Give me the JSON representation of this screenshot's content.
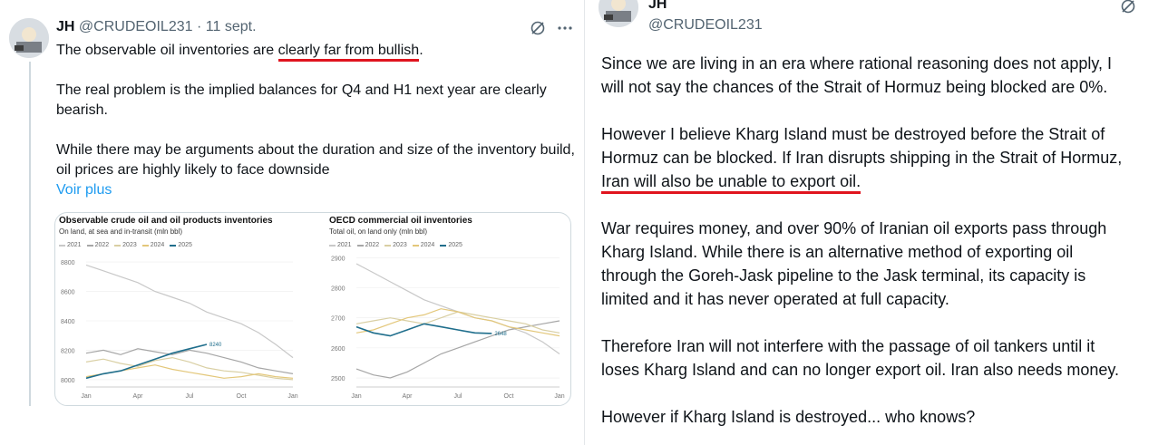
{
  "left_tweet": {
    "author_name": "JH",
    "handle": "@CRUDEOIL231",
    "separator": "·",
    "date": "11 sept.",
    "line1_prefix": "The observable oil inventories are ",
    "line1_highlight": "clearly far from bullish",
    "line1_suffix": ".",
    "para2": "The real problem is the implied balances for Q4 and H1 next year are clearly bearish.",
    "para3": "While there may be arguments about the duration and size of the inventory build, oil prices are highly likely to face downside",
    "see_more": "Voir plus",
    "more_icon": "more-icon",
    "grok_icon": "grok-icon"
  },
  "right_tweet": {
    "author_name": "JH",
    "handle": "@CRUDEOIL231",
    "grok_icon": "grok-icon",
    "lines": {
      "p1a": "Since we are living in an era where rational reasoning does not apply, I",
      "p1b": "will not say the chances of the Strait of Hormuz being blocked are 0%.",
      "p2a": "However I believe Kharg Island must be destroyed before the Strait of",
      "p2b": "Hormuz can be blocked. If Iran disrupts shipping in the Strait of Hormuz,",
      "p2c": "Iran will also be unable to export oil.",
      "p3a": "War requires money, and over 90% of Iranian oil exports pass through",
      "p3b": "Kharg Island. While there is an alternative method of exporting oil",
      "p3c": "through the Goreh-Jask pipeline to the Jask terminal, its capacity is",
      "p3d": "limited and it has never operated at full capacity.",
      "p4a": "Therefore Iran will not interfere with the passage of oil tankers until it",
      "p4b": "loses Kharg Island and can no longer export oil. Iran also needs money.",
      "p5": "However if Kharg Island is destroyed... who knows?"
    }
  },
  "colors": {
    "highlight_underline": "#e0141e",
    "link": "#1d9bf0",
    "series_2021": "#c8c8c8",
    "series_2022": "#a6a6a6",
    "series_2023": "#d9cfa3",
    "series_2024": "#e3c77a",
    "series_2025": "#1f6e8c"
  },
  "chart_data": [
    {
      "type": "line",
      "title": "Observable crude oil and oil products inventories",
      "subtitle": "On land, at sea and in-transit (mln bbl)",
      "x_ticks": [
        "Jan",
        "Apr",
        "Jul",
        "Oct",
        "Jan"
      ],
      "y_ticks": [
        "8800",
        "8600",
        "8400",
        "8200",
        "8000"
      ],
      "ylim": [
        7950,
        8850
      ],
      "last_label": "8240",
      "series": [
        {
          "name": "2021",
          "color": "#c8c8c8",
          "values": [
            8780,
            8740,
            8700,
            8660,
            8600,
            8560,
            8520,
            8460,
            8420,
            8380,
            8320,
            8240,
            8150
          ]
        },
        {
          "name": "2022",
          "color": "#a6a6a6",
          "values": [
            8180,
            8200,
            8170,
            8210,
            8190,
            8170,
            8200,
            8180,
            8150,
            8120,
            8080,
            8060,
            8040
          ]
        },
        {
          "name": "2023",
          "color": "#d9cfa3",
          "values": [
            8120,
            8140,
            8110,
            8090,
            8130,
            8150,
            8120,
            8080,
            8060,
            8050,
            8030,
            8010,
            8000
          ]
        },
        {
          "name": "2024",
          "color": "#e3c77a",
          "values": [
            8020,
            8040,
            8060,
            8080,
            8100,
            8070,
            8050,
            8030,
            8010,
            8020,
            8040,
            8020,
            8010
          ]
        },
        {
          "name": "2025",
          "color": "#1f6e8c",
          "values": [
            8010,
            8040,
            8060,
            8100,
            8140,
            8180,
            8210,
            8240
          ]
        }
      ]
    },
    {
      "type": "line",
      "title": "OECD commercial oil inventories",
      "subtitle": "Total oil, on land only (mln bbl)",
      "x_ticks": [
        "Jan",
        "Apr",
        "Jul",
        "Oct",
        "Jan"
      ],
      "y_ticks": [
        "2900",
        "2800",
        "2700",
        "2600",
        "2500"
      ],
      "ylim": [
        2470,
        2910
      ],
      "last_label": "2648",
      "series": [
        {
          "name": "2021",
          "color": "#c8c8c8",
          "values": [
            2880,
            2850,
            2820,
            2790,
            2760,
            2740,
            2720,
            2700,
            2690,
            2670,
            2650,
            2620,
            2580
          ]
        },
        {
          "name": "2022",
          "color": "#a6a6a6",
          "values": [
            2530,
            2510,
            2500,
            2520,
            2550,
            2580,
            2600,
            2620,
            2640,
            2660,
            2670,
            2680,
            2690
          ]
        },
        {
          "name": "2023",
          "color": "#d9cfa3",
          "values": [
            2680,
            2690,
            2700,
            2690,
            2680,
            2700,
            2720,
            2710,
            2700,
            2690,
            2680,
            2660,
            2650
          ]
        },
        {
          "name": "2024",
          "color": "#e3c77a",
          "values": [
            2650,
            2660,
            2680,
            2700,
            2710,
            2730,
            2720,
            2700,
            2690,
            2670,
            2660,
            2650,
            2640
          ]
        },
        {
          "name": "2025",
          "color": "#1f6e8c",
          "values": [
            2670,
            2650,
            2640,
            2660,
            2680,
            2670,
            2660,
            2650,
            2648
          ]
        }
      ]
    }
  ]
}
